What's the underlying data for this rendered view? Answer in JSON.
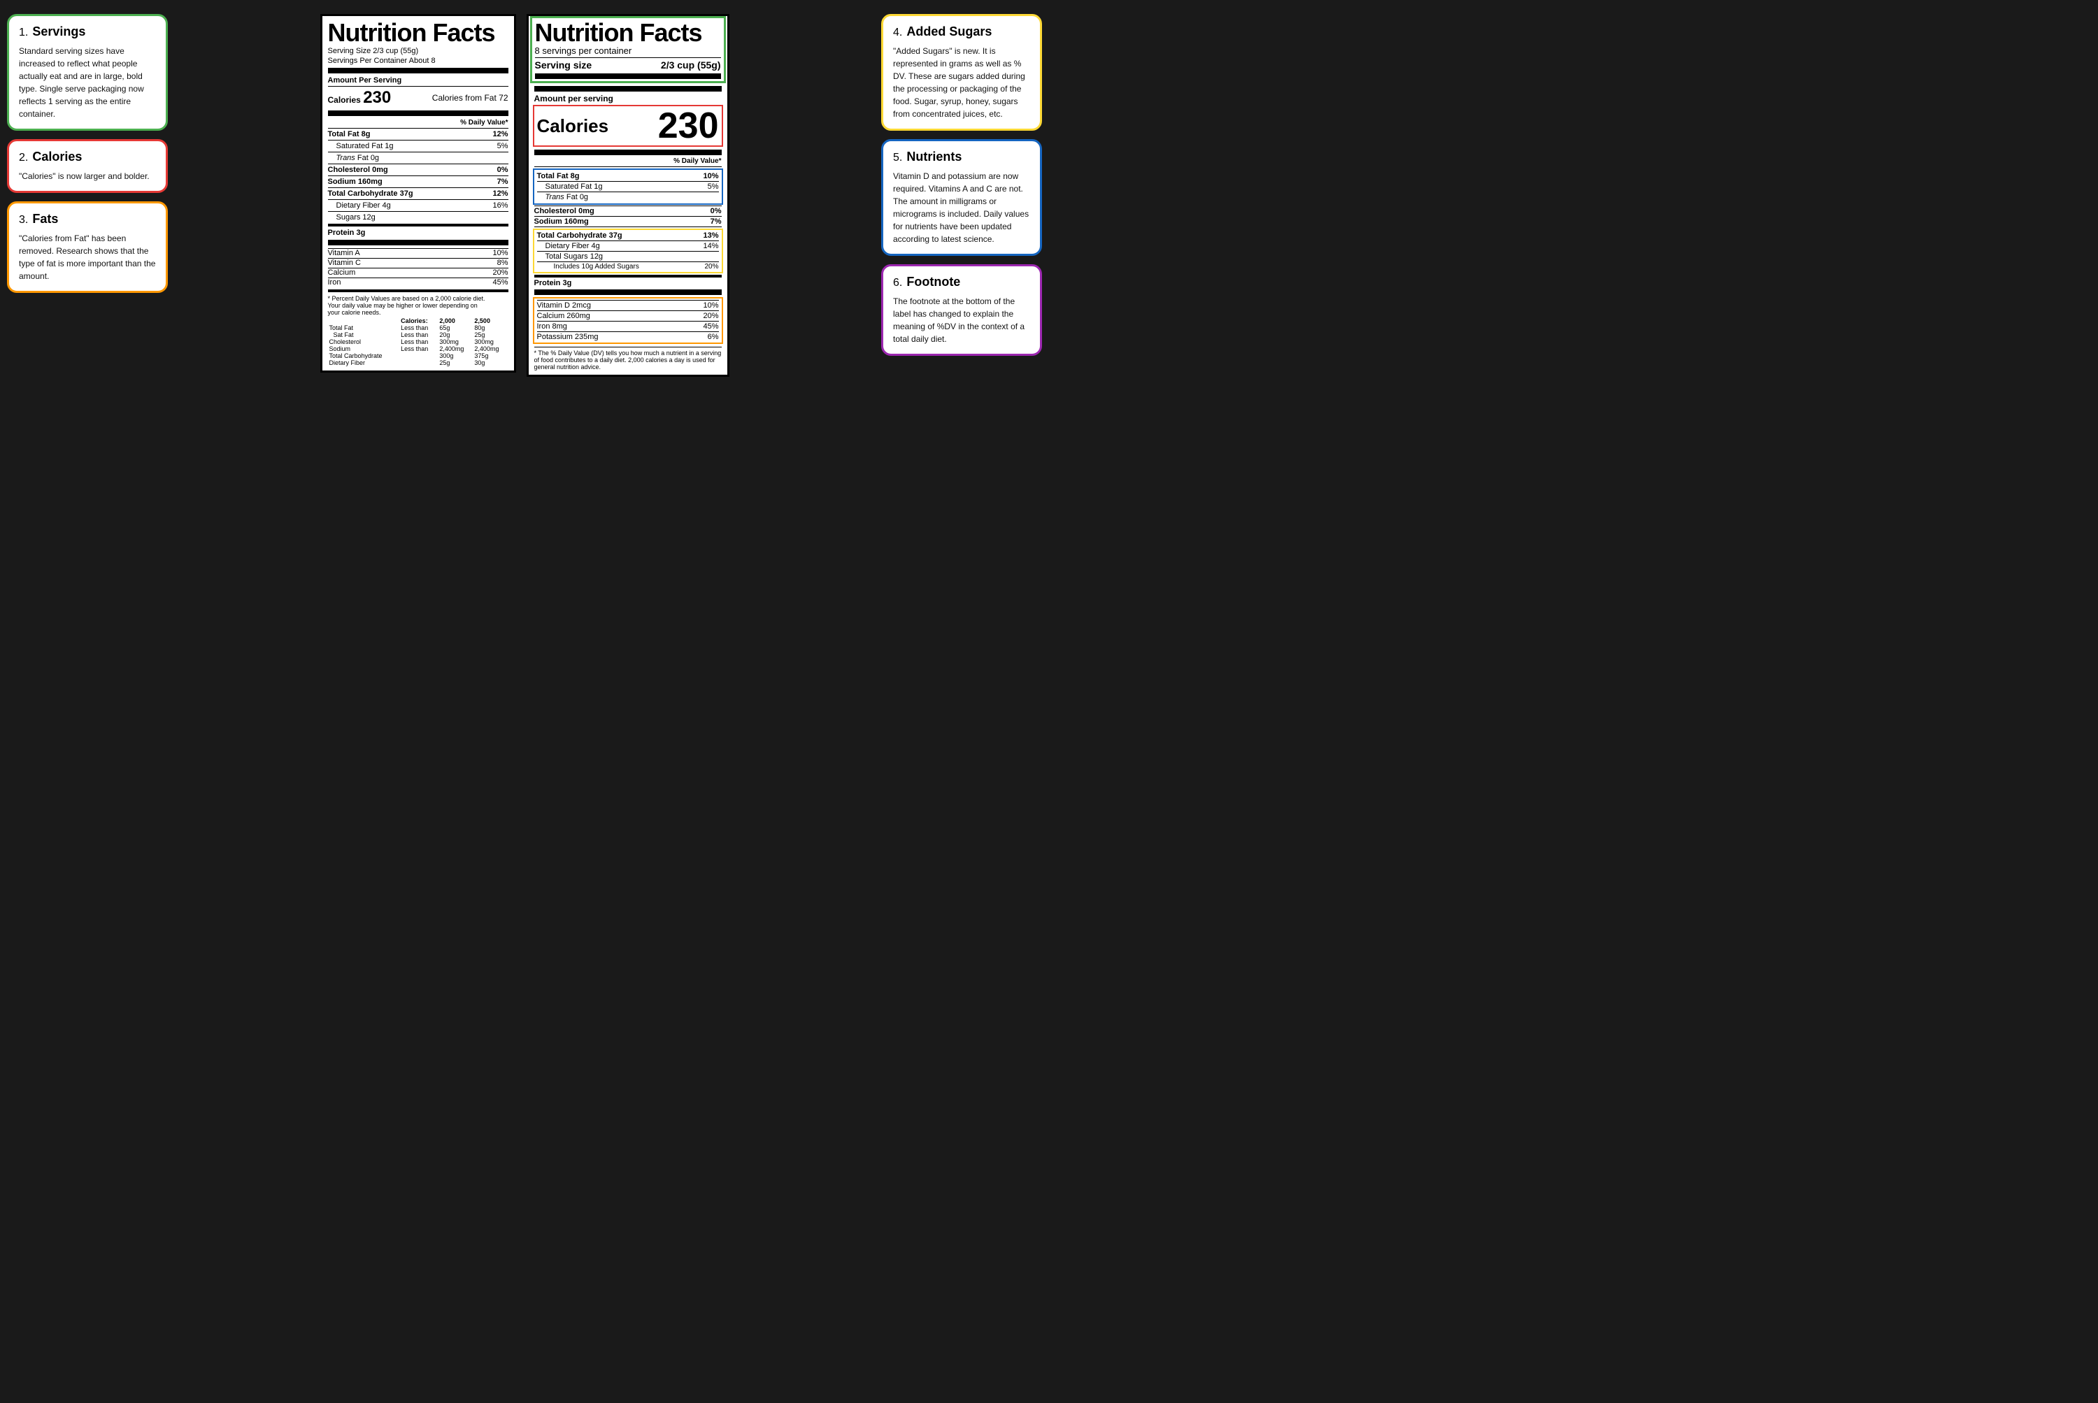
{
  "left": {
    "box1": {
      "num": "1.",
      "title": "Servings",
      "text": "Standard serving sizes have increased to reflect what people actually eat and are in large, bold type. Single serve packaging now reflects 1 serving as the entire container.",
      "color": "green"
    },
    "box2": {
      "num": "2.",
      "title": "Calories",
      "text": "\"Calories\" is now larger and bolder.",
      "color": "red"
    },
    "box3": {
      "num": "3.",
      "title": "Fats",
      "text": "\"Calories from Fat\" has been removed. Research shows that the type of fat is more important than the amount.",
      "color": "orange"
    }
  },
  "right": {
    "box4": {
      "num": "4.",
      "title": "Added Sugars",
      "text": "\"Added Sugars\" is new. It is represented in grams as well as % DV. These are sugars added during the processing or packaging of the food. Sugar, syrup, honey, sugars from concentrated juices, etc.",
      "color": "yellow"
    },
    "box5": {
      "num": "5.",
      "title": "Nutrients",
      "text": "Vitamin D and potassium are now required. Vitamins A and C are not. The amount in milligrams or micrograms is included. Daily values for nutrients have been updated according to latest science.",
      "color": "blue"
    },
    "box6": {
      "num": "6.",
      "title": "Footnote",
      "text": "The footnote at the bottom of the label has changed to explain the meaning of %DV in the context of a total daily diet.",
      "color": "purple"
    }
  },
  "old_label": {
    "title": "Nutrition Facts",
    "serving_size": "Serving Size 2/3 cup (55g)",
    "servings_per": "Servings Per Container About 8",
    "amount_per": "Amount Per Serving",
    "calories": "230",
    "calories_from_fat": "Calories from Fat 72",
    "daily_value": "% Daily Value*",
    "nutrients": [
      {
        "name": "Total Fat 8g",
        "pct": "12%",
        "bold": true,
        "indent": 0
      },
      {
        "name": "Saturated Fat 1g",
        "pct": "5%",
        "bold": false,
        "indent": 1
      },
      {
        "name": "Trans Fat 0g",
        "pct": "",
        "bold": false,
        "italic": true,
        "indent": 1
      },
      {
        "name": "Cholesterol 0mg",
        "pct": "0%",
        "bold": true,
        "indent": 0
      },
      {
        "name": "Sodium 160mg",
        "pct": "7%",
        "bold": true,
        "indent": 0
      },
      {
        "name": "Total Carbohydrate 37g",
        "pct": "12%",
        "bold": true,
        "indent": 0
      },
      {
        "name": "Dietary Fiber 4g",
        "pct": "16%",
        "bold": false,
        "indent": 1
      },
      {
        "name": "Sugars 12g",
        "pct": "",
        "bold": false,
        "indent": 1
      },
      {
        "name": "Protein 3g",
        "pct": "",
        "bold": true,
        "indent": 0
      }
    ],
    "vitamins": [
      {
        "name": "Vitamin A",
        "pct": "10%"
      },
      {
        "name": "Vitamin C",
        "pct": "8%"
      },
      {
        "name": "Calcium",
        "pct": "20%"
      },
      {
        "name": "Iron",
        "pct": "45%"
      }
    ],
    "footnote_line1": "* Percent Daily Values are based on a 2,000 calorie diet.",
    "footnote_line2": "Your daily value may be higher or lower depending on",
    "footnote_line3": "your calorie needs.",
    "footnote_table": {
      "headers": [
        "",
        "Calories:",
        "2,000",
        "2,500"
      ],
      "rows": [
        [
          "Total Fat",
          "Less than",
          "65g",
          "80g"
        ],
        [
          "Sat Fat",
          "Less than",
          "20g",
          "25g"
        ],
        [
          "Cholesterol",
          "Less than",
          "300mg",
          "300mg"
        ],
        [
          "Sodium",
          "Less than",
          "2,400mg",
          "2,400mg"
        ],
        [
          "Total Carbohydrate",
          "",
          "300g",
          "375g"
        ],
        [
          "Dietary Fiber",
          "",
          "25g",
          "30g"
        ]
      ]
    }
  },
  "new_label": {
    "title": "Nutrition Facts",
    "servings_per": "8 servings per container",
    "serving_size_label": "Serving size",
    "serving_size_value": "2/3 cup (55g)",
    "amount_per": "Amount per serving",
    "calories_label": "Calories",
    "calories_value": "230",
    "daily_value": "% Daily Value*",
    "nutrients": [
      {
        "name": "Total Fat 8g",
        "pct": "10%",
        "bold": true,
        "indent": 0
      },
      {
        "name": "Saturated Fat 1g",
        "pct": "5%",
        "bold": false,
        "indent": 1
      },
      {
        "name": "Trans Fat 0g",
        "pct": "",
        "bold": false,
        "italic": true,
        "indent": 1
      },
      {
        "name": "Cholesterol 0mg",
        "pct": "0%",
        "bold": true,
        "indent": 0
      },
      {
        "name": "Sodium 160mg",
        "pct": "7%",
        "bold": true,
        "indent": 0
      },
      {
        "name": "Total Carbohydrate 37g",
        "pct": "13%",
        "bold": true,
        "indent": 0
      },
      {
        "name": "Dietary Fiber 4g",
        "pct": "14%",
        "bold": false,
        "indent": 1
      },
      {
        "name": "Total Sugars 12g",
        "pct": "",
        "bold": false,
        "indent": 1
      },
      {
        "name": "Includes 10g Added Sugars",
        "pct": "20%",
        "bold": false,
        "indent": 2
      },
      {
        "name": "Protein 3g",
        "pct": "",
        "bold": true,
        "indent": 0
      }
    ],
    "vitamins": [
      {
        "name": "Vitamin D 2mcg",
        "pct": "10%"
      },
      {
        "name": "Calcium 260mg",
        "pct": "20%"
      },
      {
        "name": "Iron 8mg",
        "pct": "45%"
      },
      {
        "name": "Potassium 235mg",
        "pct": "6%"
      }
    ],
    "footnote": "* The % Daily Value (DV) tells you how much a nutrient in a serving of food contributes to a daily diet. 2,000 calories a day is used for general nutrition advice."
  }
}
